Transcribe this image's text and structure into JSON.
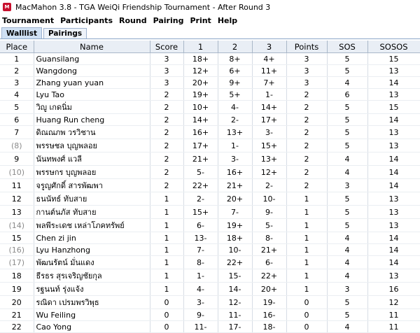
{
  "window": {
    "title": "MacMahon 3.8 - TGA WeiQi  Friendship Tournament - After Round 3"
  },
  "menu": [
    "Tournament",
    "Participants",
    "Round",
    "Pairing",
    "Print",
    "Help"
  ],
  "tabs": [
    {
      "label": "Walllist",
      "active": true
    },
    {
      "label": "Pairings",
      "active": false
    }
  ],
  "columns": [
    "Place",
    "Name",
    "Score",
    "1",
    "2",
    "3",
    "Points",
    "SOS",
    "SOSOS"
  ],
  "rows": [
    {
      "place": "1",
      "name": "Guansilang",
      "score": "3",
      "r1": "18+",
      "r2": "8+",
      "r3": "4+",
      "points": "3",
      "sos": "5",
      "sosos": "15"
    },
    {
      "place": "2",
      "name": "Wangdong",
      "score": "3",
      "r1": "12+",
      "r2": "6+",
      "r3": "11+",
      "points": "3",
      "sos": "5",
      "sosos": "13"
    },
    {
      "place": "3",
      "name": "Zhang yuan yuan",
      "score": "3",
      "r1": "20+",
      "r2": "9+",
      "r3": "7+",
      "points": "3",
      "sos": "4",
      "sosos": "14"
    },
    {
      "place": "4",
      "name": "Lyu Tao",
      "score": "2",
      "r1": "19+",
      "r2": "5+",
      "r3": "1-",
      "points": "2",
      "sos": "6",
      "sosos": "13"
    },
    {
      "place": "5",
      "name": "วิญู เกดนิ่ม",
      "score": "2",
      "r1": "10+",
      "r2": "4-",
      "r3": "14+",
      "points": "2",
      "sos": "5",
      "sosos": "15"
    },
    {
      "place": "6",
      "name": "Huang Run cheng",
      "score": "2",
      "r1": "14+",
      "r2": "2-",
      "r3": "17+",
      "points": "2",
      "sos": "5",
      "sosos": "14"
    },
    {
      "place": "7",
      "name": "ดิณณภพ วรวิชาน",
      "score": "2",
      "r1": "16+",
      "r2": "13+",
      "r3": "3-",
      "points": "2",
      "sos": "5",
      "sosos": "13"
    },
    {
      "place": "(8)",
      "name": "พรรษชล บุญพลอย",
      "score": "2",
      "r1": "17+",
      "r2": "1-",
      "r3": "15+",
      "points": "2",
      "sos": "5",
      "sosos": "13"
    },
    {
      "place": "9",
      "name": "นันทพงศ์ แวลี",
      "score": "2",
      "r1": "21+",
      "r2": "3-",
      "r3": "13+",
      "points": "2",
      "sos": "4",
      "sosos": "14"
    },
    {
      "place": "(10)",
      "name": "พรรษกร บุญพลอย",
      "score": "2",
      "r1": "5-",
      "r2": "16+",
      "r3": "12+",
      "points": "2",
      "sos": "4",
      "sosos": "14"
    },
    {
      "place": "11",
      "name": "จรูญศักดิ์ สารพัฒพา",
      "score": "2",
      "r1": "22+",
      "r2": "21+",
      "r3": "2-",
      "points": "2",
      "sos": "3",
      "sosos": "14"
    },
    {
      "place": "12",
      "name": "ธนนัทธ์ ทับสาย",
      "score": "1",
      "r1": "2-",
      "r2": "20+",
      "r3": "10-",
      "points": "1",
      "sos": "5",
      "sosos": "13"
    },
    {
      "place": "13",
      "name": "กานต์นภัส ทับสาย",
      "score": "1",
      "r1": "15+",
      "r2": "7-",
      "r3": "9-",
      "points": "1",
      "sos": "5",
      "sosos": "13"
    },
    {
      "place": "(14)",
      "name": "พลพีระเดช เหล่าโภคทรัพย์",
      "score": "1",
      "r1": "6-",
      "r2": "19+",
      "r3": "5-",
      "points": "1",
      "sos": "5",
      "sosos": "13"
    },
    {
      "place": "15",
      "name": "Chen zi jin",
      "score": "1",
      "r1": "13-",
      "r2": "18+",
      "r3": "8-",
      "points": "1",
      "sos": "4",
      "sosos": "14"
    },
    {
      "place": "(16)",
      "name": "Lyu Hanzhong",
      "score": "1",
      "r1": "7-",
      "r2": "10-",
      "r3": "21+",
      "points": "1",
      "sos": "4",
      "sosos": "14"
    },
    {
      "place": "(17)",
      "name": "พัฒนรัตน์ มั่นแดง",
      "score": "1",
      "r1": "8-",
      "r2": "22+",
      "r3": "6-",
      "points": "1",
      "sos": "4",
      "sosos": "14"
    },
    {
      "place": "18",
      "name": "ธีรธร สุรเจริญชัยกุล",
      "score": "1",
      "r1": "1-",
      "r2": "15-",
      "r3": "22+",
      "points": "1",
      "sos": "4",
      "sosos": "13"
    },
    {
      "place": "19",
      "name": "รฐนนท์ รุ่งแจ้ง",
      "score": "1",
      "r1": "4-",
      "r2": "14-",
      "r3": "20+",
      "points": "1",
      "sos": "3",
      "sosos": "16"
    },
    {
      "place": "20",
      "name": "รณิดา เปรมพรวิพุธ",
      "score": "0",
      "r1": "3-",
      "r2": "12-",
      "r3": "19-",
      "points": "0",
      "sos": "5",
      "sosos": "12"
    },
    {
      "place": "21",
      "name": "Wu Feiling",
      "score": "0",
      "r1": "9-",
      "r2": "11-",
      "r3": "16-",
      "points": "0",
      "sos": "5",
      "sosos": "11"
    },
    {
      "place": "22",
      "name": "Cao Yong",
      "score": "0",
      "r1": "11-",
      "r2": "17-",
      "r3": "18-",
      "points": "0",
      "sos": "4",
      "sosos": "11"
    }
  ],
  "colors": {
    "header_bg": "#e9eef5",
    "tab_active": "#cfe0f3",
    "icon": "#c8102e"
  },
  "icons": {
    "app": "macmahon-app-icon"
  }
}
